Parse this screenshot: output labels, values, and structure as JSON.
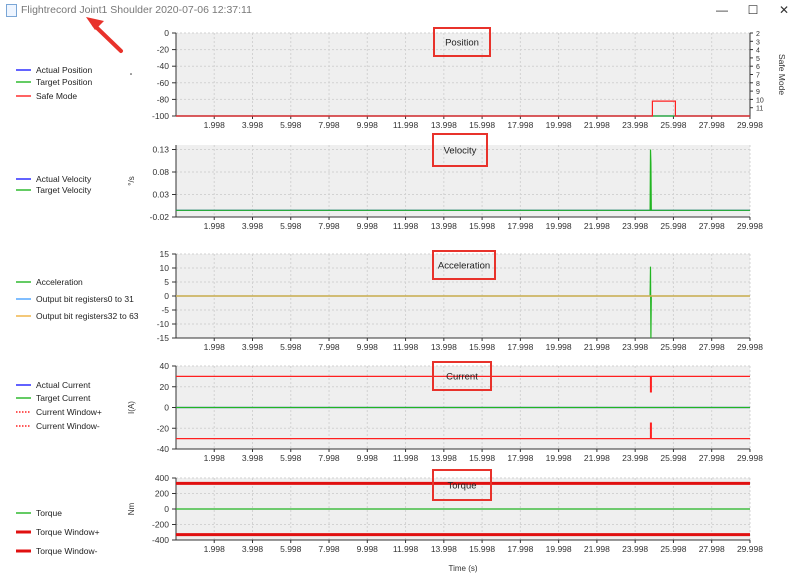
{
  "window": {
    "title": "Flightrecord Joint1 Shoulder 2020-07-06 12:37:11",
    "controls": {
      "minimize": "—",
      "maximize": "☐",
      "close": "✕"
    }
  },
  "x_axis": {
    "label": "Time (s)",
    "ticks": [
      "1.998",
      "3.998",
      "5.998",
      "7.998",
      "9.998",
      "11.998",
      "13.998",
      "15.998",
      "17.998",
      "19.998",
      "21.998",
      "23.998",
      "25.998",
      "27.998",
      "29.998"
    ]
  },
  "panels": [
    {
      "id": "position",
      "title": "Position",
      "ylabel": "",
      "right_label": "Safe Mode",
      "right_ticks": [
        "11",
        "10",
        "9",
        "8",
        "7",
        "6",
        "5",
        "4",
        "3",
        "2"
      ],
      "y_ticks": [
        "0",
        "-20",
        "-40",
        "-60",
        "-80",
        "-100"
      ],
      "legend": [
        {
          "label": "Actual Position",
          "color": "#2020ff",
          "style": "solid"
        },
        {
          "label": "Target Position",
          "color": "#22b522",
          "style": "solid"
        },
        {
          "label": "Safe Mode",
          "color": "#ff2020",
          "style": "solid"
        }
      ]
    },
    {
      "id": "velocity",
      "title": "Velocity",
      "ylabel": "°/s",
      "y_ticks": [
        "0.13",
        "0.08",
        "0.03",
        "-0.02"
      ],
      "legend": [
        {
          "label": "Actual Velocity",
          "color": "#2020ff",
          "style": "solid"
        },
        {
          "label": "Target Velocity",
          "color": "#22b522",
          "style": "solid"
        }
      ]
    },
    {
      "id": "acceleration",
      "title": "Acceleration",
      "ylabel": "",
      "y_ticks": [
        "15",
        "10",
        "5",
        "0",
        "-5",
        "-10",
        "-15"
      ],
      "legend": [
        {
          "label": "Acceleration",
          "color": "#22b522",
          "style": "solid"
        },
        {
          "label": "Output bit registers0 to 31",
          "color": "#4aa3ff",
          "style": "solid"
        },
        {
          "label": "Output bit registers32 to 63",
          "color": "#f0b040",
          "style": "solid"
        }
      ]
    },
    {
      "id": "current",
      "title": "Current",
      "ylabel": "I(A)",
      "y_ticks": [
        "40",
        "20",
        "0",
        "-20",
        "-40"
      ],
      "legend": [
        {
          "label": "Actual Current",
          "color": "#2020ff",
          "style": "solid"
        },
        {
          "label": "Target Current",
          "color": "#22b522",
          "style": "solid"
        },
        {
          "label": "Current Window+",
          "color": "#ff2020",
          "style": "dotted"
        },
        {
          "label": "Current Window-",
          "color": "#ff2020",
          "style": "dotted"
        }
      ]
    },
    {
      "id": "torque",
      "title": "Torque",
      "ylabel": "Nm",
      "y_ticks": [
        "400",
        "200",
        "0",
        "-200",
        "-400"
      ],
      "legend": [
        {
          "label": "Torque",
          "color": "#22b522",
          "style": "solid"
        },
        {
          "label": "Torque Window+",
          "color": "#e01010",
          "style": "thick"
        },
        {
          "label": "Torque Window-",
          "color": "#e01010",
          "style": "thick"
        }
      ]
    }
  ],
  "chart_data": [
    {
      "type": "line",
      "title": "Position",
      "xlabel": "",
      "ylabel": "",
      "xlim": [
        0,
        30
      ],
      "ylim": [
        -100,
        0
      ],
      "x_ticks": [
        1.998,
        3.998,
        5.998,
        7.998,
        9.998,
        11.998,
        13.998,
        15.998,
        17.998,
        19.998,
        21.998,
        23.998,
        25.998,
        27.998,
        29.998
      ],
      "y_ticks": [
        0,
        -20,
        -40,
        -60,
        -80,
        -100
      ],
      "grid": true,
      "legend": "left",
      "series": [
        {
          "name": "Actual Position",
          "color": "#2020ff",
          "x": [
            0,
            30
          ],
          "y": [
            -100,
            -100
          ]
        },
        {
          "name": "Target Position",
          "color": "#22b522",
          "x": [
            0,
            30
          ],
          "y": [
            -100,
            -100
          ]
        },
        {
          "name": "Safe Mode",
          "color": "#ff2020",
          "axis": "right",
          "x": [
            0,
            24.9,
            24.9,
            26.1,
            26.1,
            30
          ],
          "y": [
            1,
            1,
            2.8,
            2.8,
            1,
            1
          ]
        }
      ],
      "right_axis": {
        "label": "Safe Mode",
        "ylim": [
          1,
          11
        ],
        "ticks": [
          2,
          3,
          4,
          5,
          6,
          7,
          8,
          9,
          10,
          11
        ]
      }
    },
    {
      "type": "line",
      "title": "Velocity",
      "xlabel": "",
      "ylabel": "°/s",
      "xlim": [
        0,
        30
      ],
      "ylim": [
        -0.02,
        0.14
      ],
      "y_ticks": [
        0.13,
        0.08,
        0.03,
        -0.02
      ],
      "grid": true,
      "legend": "left",
      "series": [
        {
          "name": "Actual Velocity",
          "color": "#2020ff",
          "x": [
            0,
            30
          ],
          "y": [
            -0.005,
            -0.005
          ]
        },
        {
          "name": "Target Velocity",
          "color": "#22b522",
          "x": [
            0,
            24.78,
            24.8,
            24.82,
            24.84,
            30
          ],
          "y": [
            -0.005,
            -0.005,
            0.13,
            0.1,
            -0.005,
            -0.005
          ]
        }
      ]
    },
    {
      "type": "line",
      "title": "Acceleration",
      "xlabel": "",
      "ylabel": "",
      "xlim": [
        0,
        30
      ],
      "ylim": [
        -15,
        15
      ],
      "y_ticks": [
        15,
        10,
        5,
        0,
        -5,
        -10,
        -15
      ],
      "grid": true,
      "legend": "left",
      "series": [
        {
          "name": "Acceleration",
          "color": "#22b522",
          "x": [
            0,
            24.78,
            24.8,
            24.82,
            24.84,
            30
          ],
          "y": [
            0,
            0,
            10.5,
            -15,
            0,
            0
          ]
        },
        {
          "name": "Output bit registers0 to 31",
          "color": "#4aa3ff",
          "x": [
            0,
            30
          ],
          "y": [
            0,
            0
          ]
        },
        {
          "name": "Output bit registers32 to 63",
          "color": "#f0b040",
          "x": [
            0,
            30
          ],
          "y": [
            0,
            0
          ]
        }
      ]
    },
    {
      "type": "line",
      "title": "Current",
      "xlabel": "",
      "ylabel": "I(A)",
      "xlim": [
        0,
        30
      ],
      "ylim": [
        -40,
        40
      ],
      "y_ticks": [
        40,
        20,
        0,
        -20,
        -40
      ],
      "grid": true,
      "legend": "left",
      "series": [
        {
          "name": "Actual Current",
          "color": "#2020ff",
          "x": [
            0,
            30
          ],
          "y": [
            0,
            0
          ]
        },
        {
          "name": "Target Current",
          "color": "#22b522",
          "x": [
            0,
            30
          ],
          "y": [
            0,
            0
          ]
        },
        {
          "name": "Current Window+",
          "color": "#ff2020",
          "x": [
            0,
            24.8,
            24.8,
            24.84,
            24.84,
            30
          ],
          "y": [
            30,
            30,
            15,
            15,
            30,
            30
          ]
        },
        {
          "name": "Current Window-",
          "color": "#ff2020",
          "x": [
            0,
            24.8,
            24.8,
            24.84,
            24.84,
            30
          ],
          "y": [
            -30,
            -30,
            -15,
            -15,
            -30,
            -30
          ]
        }
      ]
    },
    {
      "type": "line",
      "title": "Torque",
      "xlabel": "Time (s)",
      "ylabel": "Nm",
      "xlim": [
        0,
        30
      ],
      "ylim": [
        -400,
        400
      ],
      "y_ticks": [
        400,
        200,
        0,
        -200,
        -400
      ],
      "grid": true,
      "legend": "left",
      "series": [
        {
          "name": "Torque",
          "color": "#22b522",
          "x": [
            0,
            30
          ],
          "y": [
            0,
            0
          ]
        },
        {
          "name": "Torque Window+",
          "color": "#e01010",
          "x": [
            0,
            30
          ],
          "y": [
            330,
            330
          ]
        },
        {
          "name": "Torque Window-",
          "color": "#e01010",
          "x": [
            0,
            30
          ],
          "y": [
            -330,
            -330
          ]
        }
      ]
    }
  ]
}
